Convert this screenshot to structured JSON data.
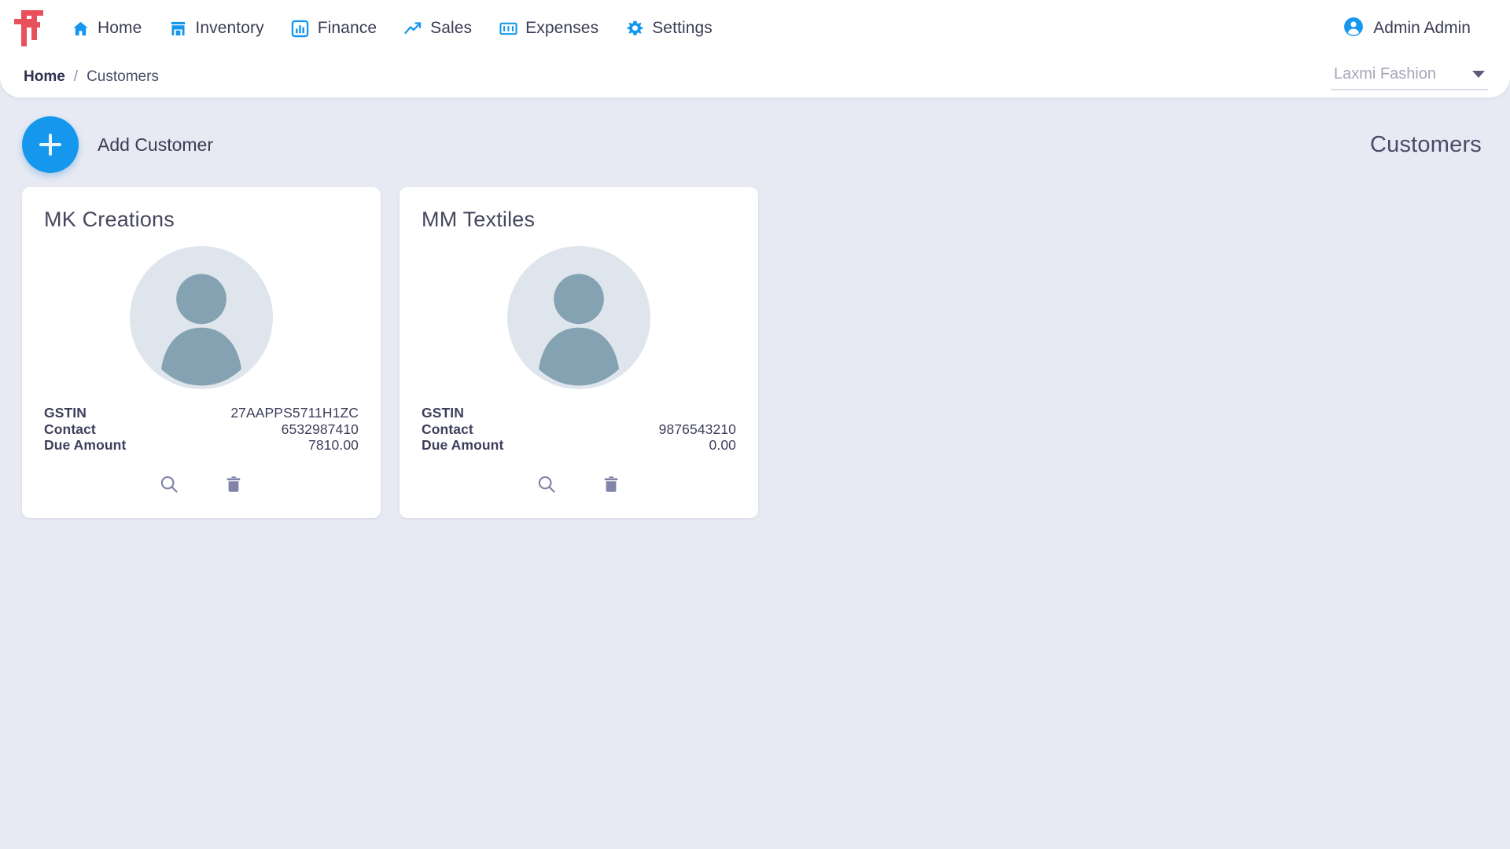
{
  "brand": {
    "logo_icon": "lf-monogram-logo",
    "logo_color": "#e8505b"
  },
  "topnav": {
    "accent_color": "#1597ee",
    "items": [
      {
        "label": "Home",
        "icon": "home-icon"
      },
      {
        "label": "Inventory",
        "icon": "store-icon"
      },
      {
        "label": "Finance",
        "icon": "bar-chart-icon"
      },
      {
        "label": "Sales",
        "icon": "trending-up-icon"
      },
      {
        "label": "Expenses",
        "icon": "money-icon"
      },
      {
        "label": "Settings",
        "icon": "gear-icon"
      }
    ],
    "account": {
      "name": "Admin Admin",
      "icon": "account-circle-icon"
    }
  },
  "breadcrumb": {
    "home": "Home",
    "separator": "/",
    "current": "Customers"
  },
  "org_selector": {
    "value": "Laxmi Fashion",
    "icon": "chevron-down-icon"
  },
  "page": {
    "title": "Customers",
    "add_button": {
      "label": "Add Customer",
      "icon": "plus-icon"
    },
    "row_labels": {
      "gstin": "GSTIN",
      "contact": "Contact",
      "due_amount": "Due Amount"
    },
    "actions": {
      "view": "search-icon",
      "delete": "trash-icon"
    },
    "customers": [
      {
        "name": "MK Creations",
        "avatar": "person-avatar-placeholder",
        "gstin": "27AAPPS5711H1ZC",
        "contact": "6532987410",
        "due_amount": "7810.00"
      },
      {
        "name": "MM Textiles",
        "avatar": "person-avatar-placeholder",
        "gstin": "",
        "contact": "9876543210",
        "due_amount": "0.00"
      }
    ]
  }
}
